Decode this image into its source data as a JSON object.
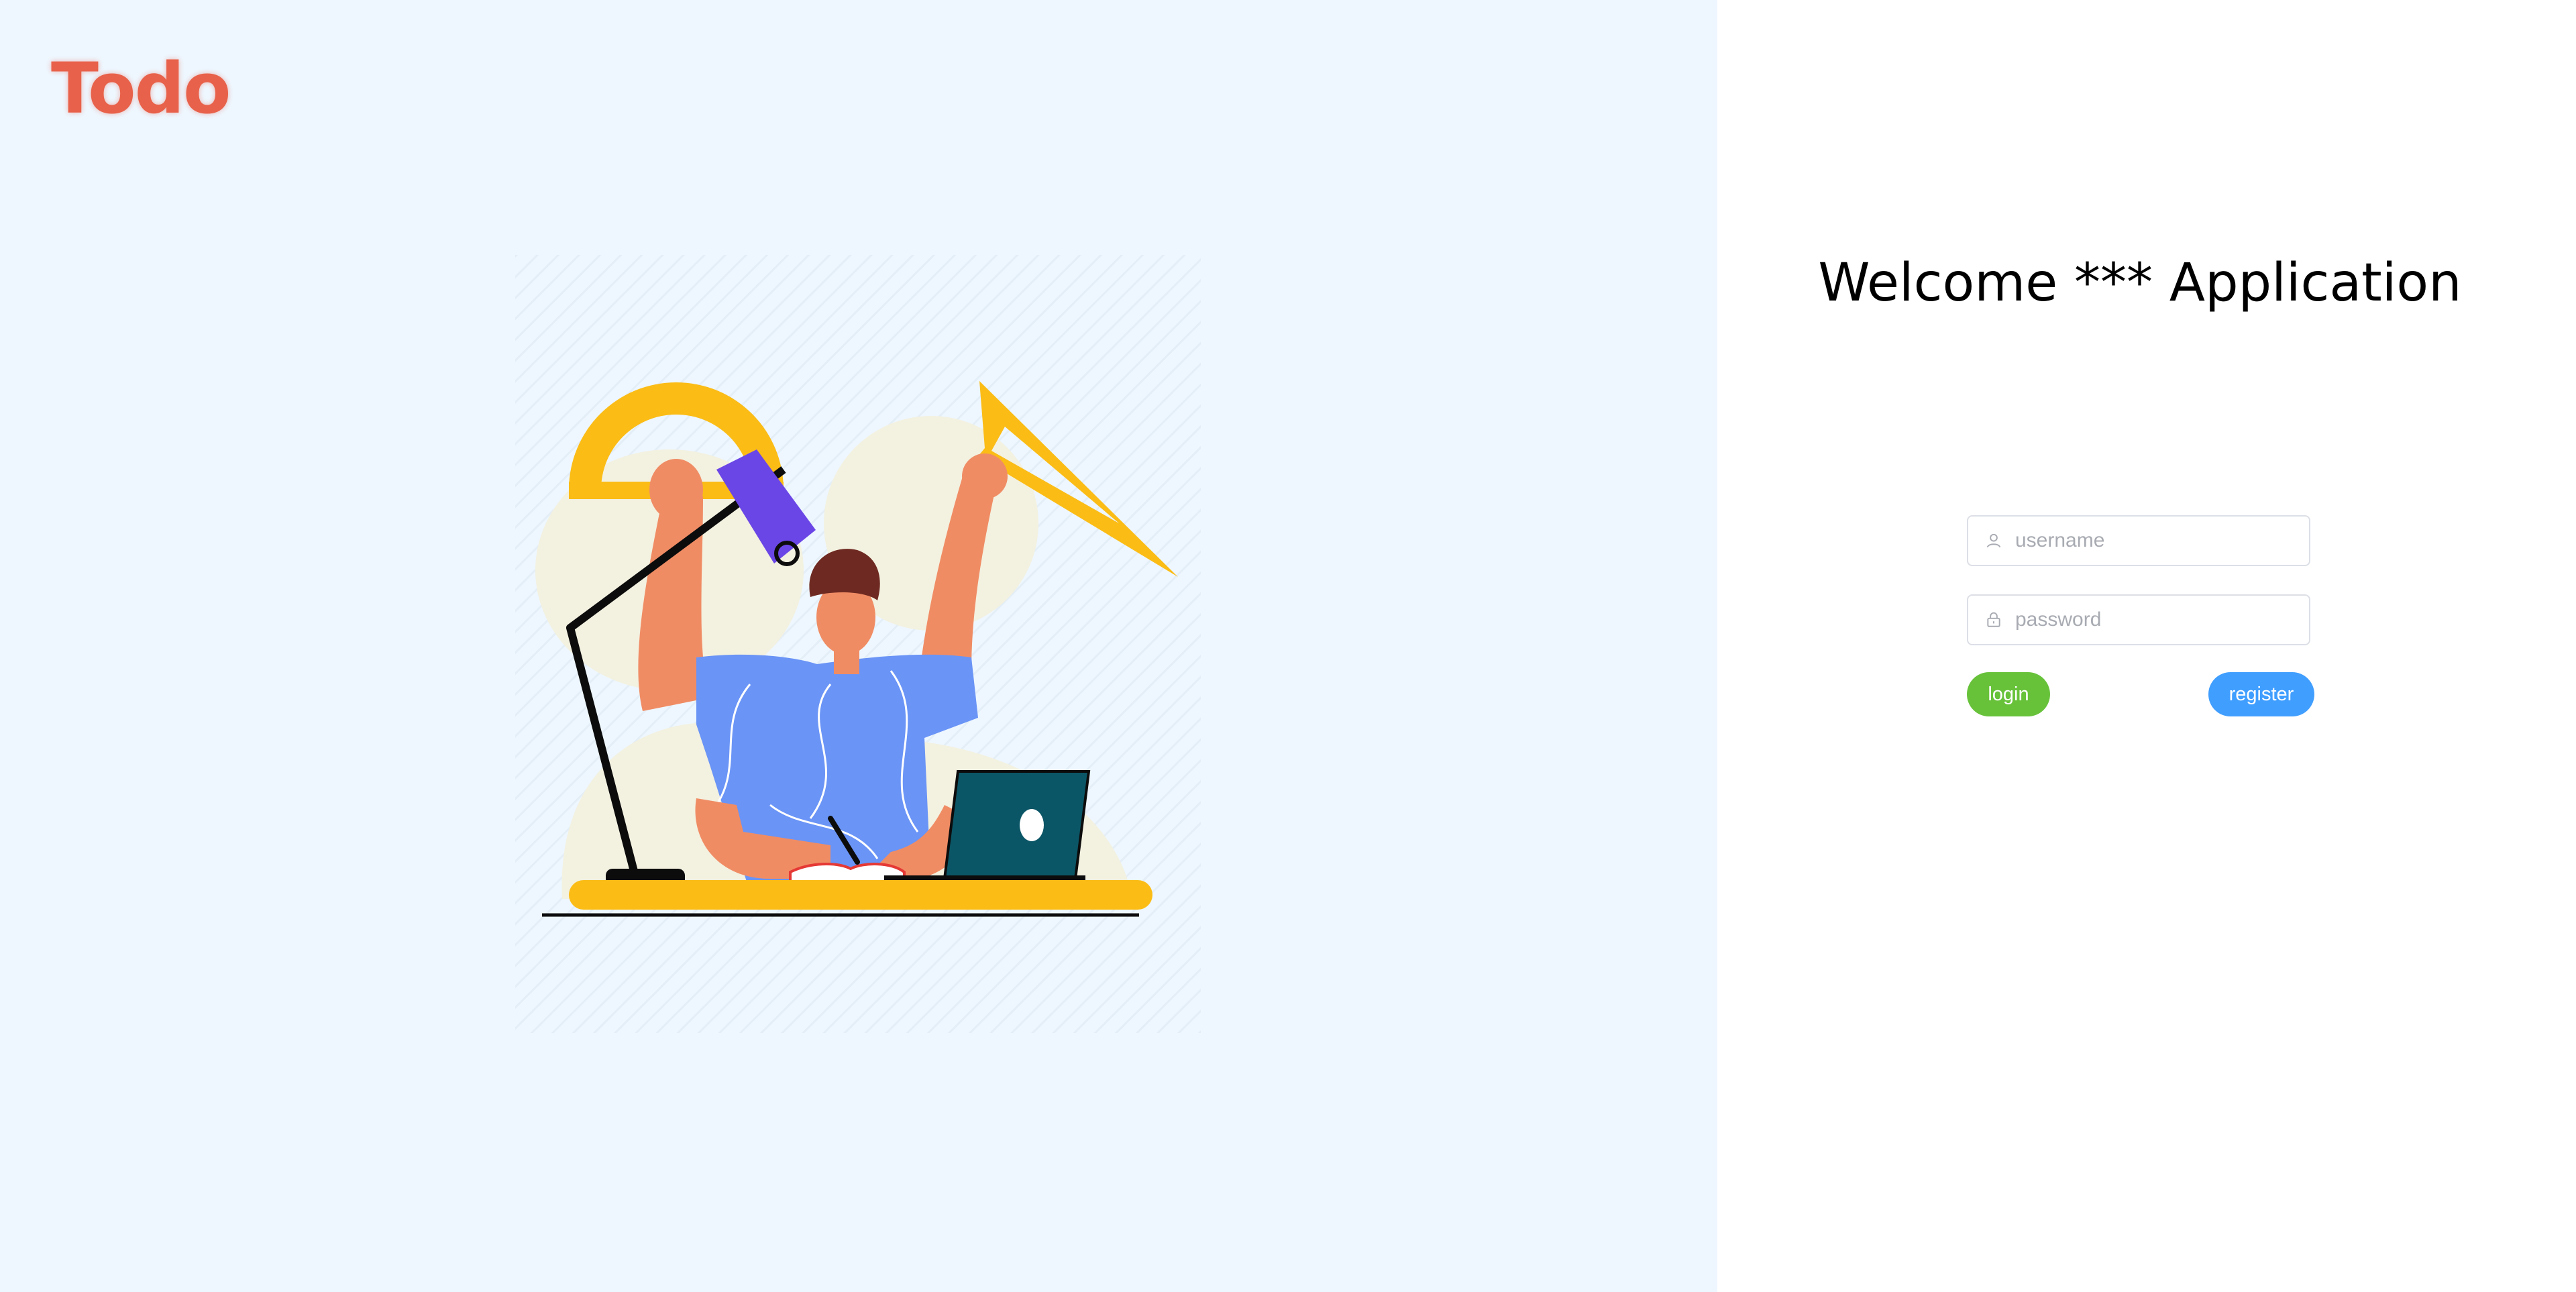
{
  "brand": {
    "logo_text": "Todo",
    "logo_color": "#E8614A"
  },
  "illustration": {
    "subject": "person-at-desk-with-lamp-laptop-protractor-triangle-ruler"
  },
  "auth": {
    "heading": "Welcome *** Application",
    "username": {
      "placeholder": "username",
      "value": "",
      "icon": "user-icon"
    },
    "password": {
      "placeholder": "password",
      "value": "",
      "icon": "lock-icon"
    },
    "login_label": "login",
    "register_label": "register"
  },
  "colors": {
    "left_background": "#EEF7FF",
    "right_background": "#FFFFFF",
    "login_button": "#67C23A",
    "register_button": "#409EFF"
  }
}
